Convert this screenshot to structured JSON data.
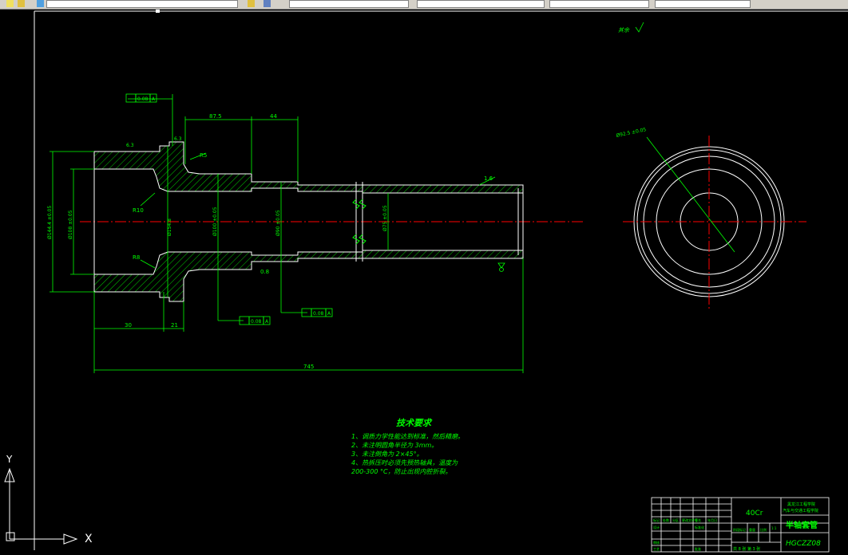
{
  "toolbar": {
    "dropdowns": [
      "",
      "",
      "",
      "",
      ""
    ]
  },
  "drawing": {
    "roughness_note": "其余",
    "dims": {
      "d87": "87.5",
      "d44": "44",
      "d30": "30",
      "d21": "21",
      "total": "745",
      "r5": "R5",
      "r10": "R10",
      "r8": "R8",
      "d16": "1.6",
      "d08": "0.8",
      "c3": "6.3",
      "c5": "6.3",
      "d_outer": "Ø144.4 ±0.05",
      "d_inner": "Ø108 ±0.05",
      "d_mid": "Ø154.8",
      "d_100": "Ø100 ±0.05",
      "d_90": "Ø90 ±0.05",
      "d_75": "Ø75 ±0.05",
      "side_d": "Ø92.5 ±0.05"
    },
    "tolerances": {
      "t1": "0.08",
      "t1_ref": "A",
      "t2": "0.08",
      "t2_ref": "A",
      "t3": "0.08",
      "t3_ref": "A"
    }
  },
  "tech": {
    "title": "技术要求",
    "items": [
      "1、调质力学性能达到标准，然后精磨。",
      "2、未注明圆角半径为 3mm。",
      "3、未注倒角为 2×45°。",
      "4、热拆压时必须先预热轴具，温度为",
      "    200-300 °C，防止出现内腔折裂。"
    ]
  },
  "title_block": {
    "material": "40Cr",
    "part_name": "半轴套管",
    "drawing_no": "HGCZZ08",
    "company_line1": "黑龙江工程学院",
    "company_line2": "汽车与交通工程学院",
    "scale": "1:1",
    "row_labels": [
      "标记",
      "处数",
      "分区",
      "更改文件号",
      "签名",
      "年月日"
    ],
    "roles": [
      "设计",
      "标准化",
      "审核",
      "工艺",
      "批准"
    ],
    "sheet_info": "共 8 张  第 3 张",
    "stage_labels": [
      "阶段标记",
      "重量",
      "比例"
    ]
  },
  "ucs": {
    "x_label": "X",
    "y_label": "Y"
  }
}
